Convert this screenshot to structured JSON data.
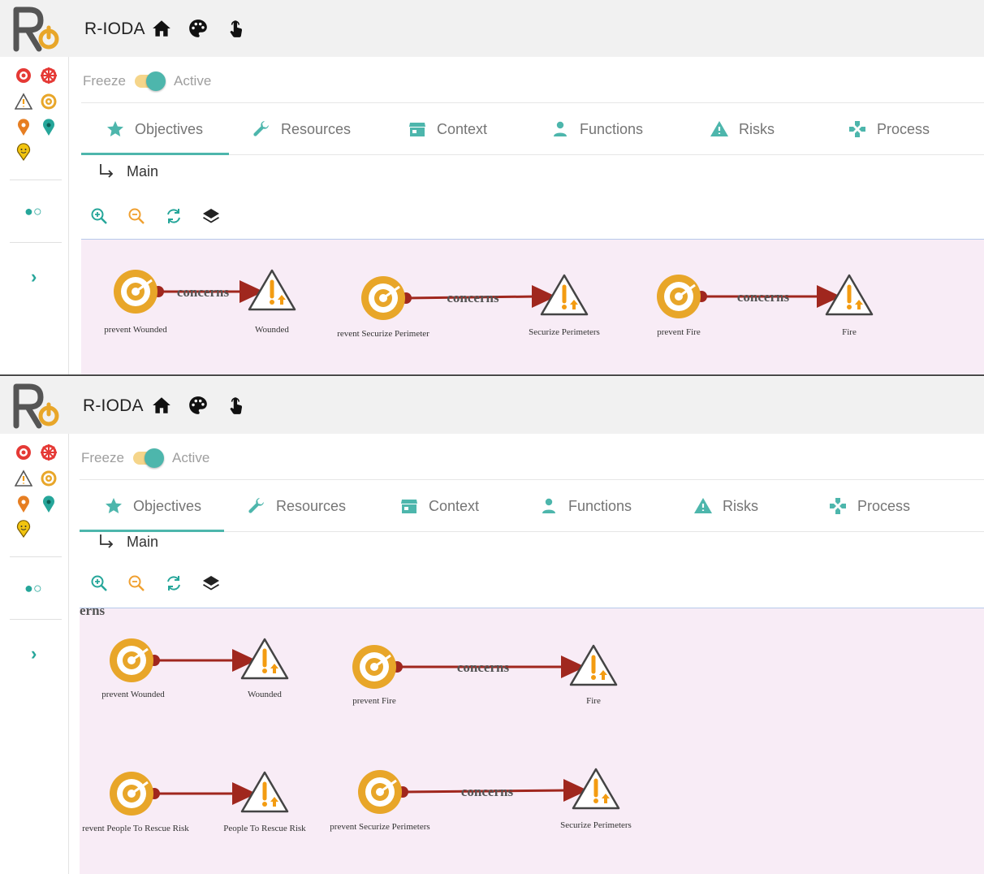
{
  "app": {
    "title": "R-IODA"
  },
  "header_icons": [
    "home-icon",
    "palette-icon",
    "touch-icon"
  ],
  "sidebar_icons": [
    "target-red-icon",
    "crosshair-red-icon",
    "warning-icon",
    "objective-target-icon",
    "pin-orange-icon",
    "pin-teal-icon",
    "pin-face-icon"
  ],
  "controls": {
    "freeze_label": "Freeze",
    "active_label": "Active",
    "active": true
  },
  "tabs": [
    {
      "label": "Objectives",
      "icon": "star-icon",
      "active": true
    },
    {
      "label": "Resources",
      "icon": "wrench-icon",
      "active": false
    },
    {
      "label": "Context",
      "icon": "store-icon",
      "active": false
    },
    {
      "label": "Functions",
      "icon": "person-icon",
      "active": false
    },
    {
      "label": "Risks",
      "icon": "warning-icon",
      "active": false
    },
    {
      "label": "Process",
      "icon": "gamepad-icon",
      "active": false
    }
  ],
  "breadcrumb": {
    "label": "Main"
  },
  "zoom_tools": [
    "zoom-in-icon",
    "zoom-out-icon",
    "refresh-icon",
    "layers-icon"
  ],
  "colors": {
    "accent": "#4db6ac",
    "arrow": "#a0271e",
    "target": "#e8a629",
    "canvas": "#f8ecf6"
  },
  "graph_top": {
    "nodes": [
      {
        "id": "t1",
        "type": "objective",
        "label": "prevent Wounded"
      },
      {
        "id": "t2",
        "type": "risk",
        "label": "Wounded"
      },
      {
        "id": "t3",
        "type": "objective",
        "label": "revent Securize Perimeter"
      },
      {
        "id": "t4",
        "type": "risk",
        "label": "Securize Perimeters"
      },
      {
        "id": "t5",
        "type": "objective",
        "label": "prevent Fire"
      },
      {
        "id": "t6",
        "type": "risk",
        "label": "Fire"
      }
    ],
    "edges": [
      {
        "from": "t1",
        "to": "t2",
        "label": "concerns"
      },
      {
        "from": "t3",
        "to": "t4",
        "label": "concerns"
      },
      {
        "from": "t5",
        "to": "t6",
        "label": "concerns"
      }
    ]
  },
  "graph_bottom": {
    "cut_label": "erns",
    "nodes": [
      {
        "id": "b1",
        "type": "objective",
        "label": "prevent Wounded"
      },
      {
        "id": "b2",
        "type": "risk",
        "label": "Wounded"
      },
      {
        "id": "b3",
        "type": "objective",
        "label": "prevent Fire"
      },
      {
        "id": "b4",
        "type": "risk",
        "label": "Fire"
      },
      {
        "id": "b5",
        "type": "objective",
        "label": "revent People To Rescue Risk"
      },
      {
        "id": "b6",
        "type": "risk",
        "label": "People To Rescue Risk"
      },
      {
        "id": "b7",
        "type": "objective",
        "label": "prevent Securize Perimeters"
      },
      {
        "id": "b8",
        "type": "risk",
        "label": "Securize Perimeters"
      }
    ],
    "edges": [
      {
        "from": "b1",
        "to": "b2",
        "label": ""
      },
      {
        "from": "b3",
        "to": "b4",
        "label": "concerns"
      },
      {
        "from": "b5",
        "to": "b6",
        "label": ""
      },
      {
        "from": "b7",
        "to": "b8",
        "label": "concerns"
      }
    ]
  }
}
